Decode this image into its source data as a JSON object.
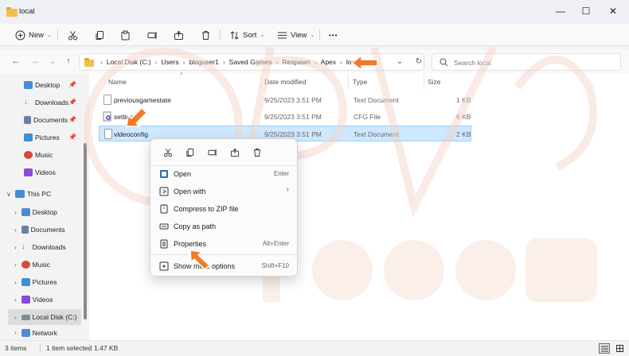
{
  "window": {
    "title": "local",
    "controls": {
      "minimize": "—",
      "maximize": "☐",
      "close": "✕"
    }
  },
  "toolbar": {
    "new_label": "New",
    "sort_label": "Sort",
    "view_label": "View",
    "more_label": "•••"
  },
  "nav": {
    "back": "←",
    "forward": "→",
    "history": "⌄",
    "up": "↑",
    "refresh": "↻",
    "dropdown": "⌄"
  },
  "breadcrumbs": [
    "Local Disk (C:)",
    "Users",
    "bloguser1",
    "Saved Games",
    "Respawn",
    "Apex",
    "local"
  ],
  "search": {
    "placeholder": "Search local"
  },
  "sidebar": {
    "quick_access": [
      {
        "label": "Desktop",
        "icon": "desktop-icon",
        "color": "#4a8bd6"
      },
      {
        "label": "Downloads",
        "icon": "downloads-icon",
        "color": "#3a9b5a"
      },
      {
        "label": "Documents",
        "icon": "documents-icon",
        "color": "#6b7fa6"
      },
      {
        "label": "Pictures",
        "icon": "pictures-icon",
        "color": "#3c8fd0"
      },
      {
        "label": "Music",
        "icon": "music-icon",
        "color": "#d64a3a"
      },
      {
        "label": "Videos",
        "icon": "videos-icon",
        "color": "#8a4ad6"
      }
    ],
    "this_pc_label": "This PC",
    "this_pc_items": [
      {
        "label": "Desktop",
        "icon": "desktop-icon",
        "color": "#4a8bd6"
      },
      {
        "label": "Documents",
        "icon": "documents-icon",
        "color": "#6b7fa6"
      },
      {
        "label": "Downloads",
        "icon": "downloads-icon",
        "color": "#3a9b5a"
      },
      {
        "label": "Music",
        "icon": "music-icon",
        "color": "#d64a3a"
      },
      {
        "label": "Pictures",
        "icon": "pictures-icon",
        "color": "#3c8fd0"
      },
      {
        "label": "Videos",
        "icon": "videos-icon",
        "color": "#8a4ad6"
      },
      {
        "label": "Local Disk (C:)",
        "icon": "drive-icon",
        "color": "#7f8c99"
      }
    ],
    "network_label": "Network"
  },
  "columns": {
    "name": "Name",
    "date": "Date modified",
    "type": "Type",
    "size": "Size"
  },
  "files": [
    {
      "name": "previousgamestate",
      "date": "9/25/2023 3:51 PM",
      "type": "Text Document",
      "size": "1 KB"
    },
    {
      "name": "settings",
      "date": "9/25/2023 3:51 PM",
      "type": "CFG File",
      "size": "6 KB"
    },
    {
      "name": "videoconfig",
      "date": "9/25/2023 3:51 PM",
      "type": "Text Document",
      "size": "2 KB"
    }
  ],
  "status": {
    "items_count": "3 items",
    "selected": "1 item selected",
    "size": "1.47 KB"
  },
  "context_menu": {
    "quick_actions": [
      "cut-icon",
      "copy-icon",
      "rename-icon",
      "share-icon",
      "delete-icon"
    ],
    "items": [
      {
        "label": "Open",
        "shortcut": "Enter",
        "icon": "open-icon"
      },
      {
        "label": "Open with",
        "shortcut": "›",
        "icon": "open-with-icon"
      },
      {
        "label": "Compress to ZIP file",
        "shortcut": "",
        "icon": "zip-icon"
      },
      {
        "label": "Copy as path",
        "shortcut": "",
        "icon": "copy-path-icon"
      },
      {
        "label": "Properties",
        "shortcut": "Alt+Enter",
        "icon": "properties-icon"
      },
      {
        "label": "Show more options",
        "shortcut": "Shift+F10",
        "icon": "more-options-icon"
      }
    ]
  },
  "colors": {
    "selection": "#cde8ff",
    "annotation_arrow": "#f07a2a",
    "accent": "#0067c0"
  }
}
